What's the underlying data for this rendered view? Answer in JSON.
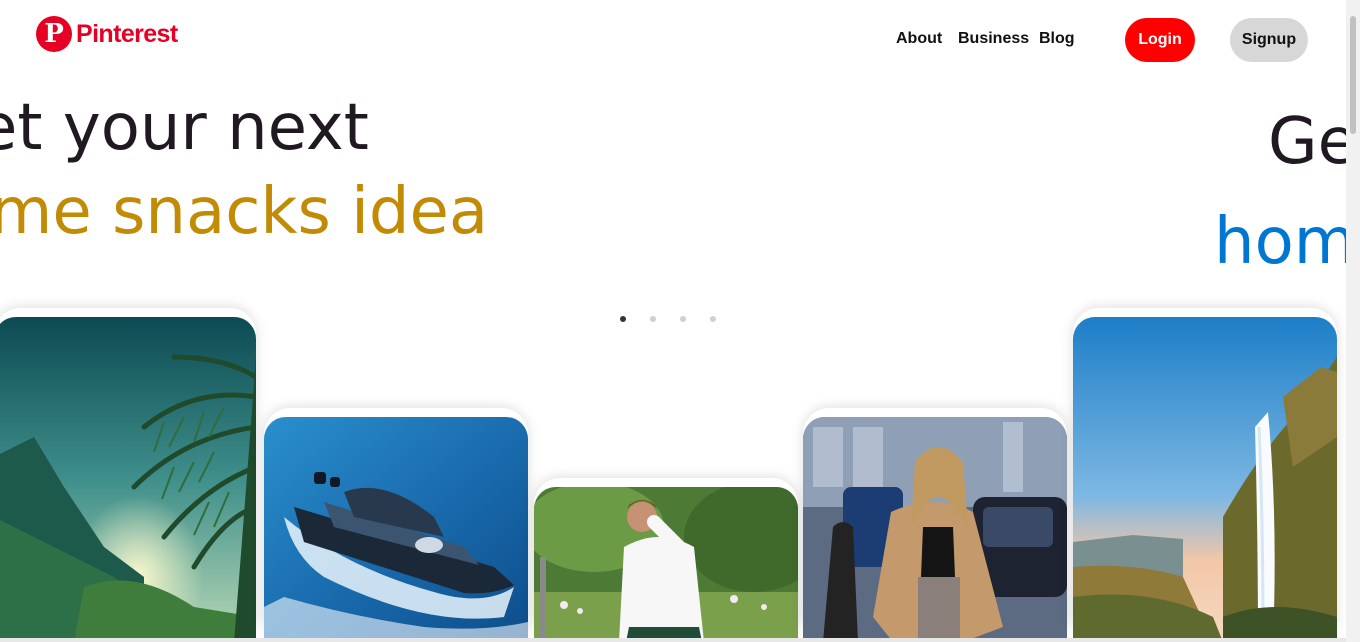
{
  "brand": {
    "logo_mark": "P",
    "name": "Pinterest",
    "color": "#e60023"
  },
  "nav": {
    "links": [
      {
        "label": "About"
      },
      {
        "label": "Business"
      },
      {
        "label": "Blog"
      }
    ],
    "login_label": "Login",
    "signup_label": "Signup"
  },
  "hero": {
    "left": {
      "line1": "et your next",
      "line2": "me snacks idea",
      "line2_color": "#c28b05"
    },
    "right": {
      "line1": "Ge",
      "line2": "hom",
      "line2_color": "#0076d3"
    }
  },
  "carousel": {
    "dot_count": 4,
    "active_index": 0
  },
  "cards": [
    {
      "subject": "tropical-mountain-palm-image"
    },
    {
      "subject": "luxury-yacht-image"
    },
    {
      "subject": "man-white-shirt-image"
    },
    {
      "subject": "woman-street-fashion-image"
    },
    {
      "subject": "waterfall-cliff-image"
    }
  ]
}
